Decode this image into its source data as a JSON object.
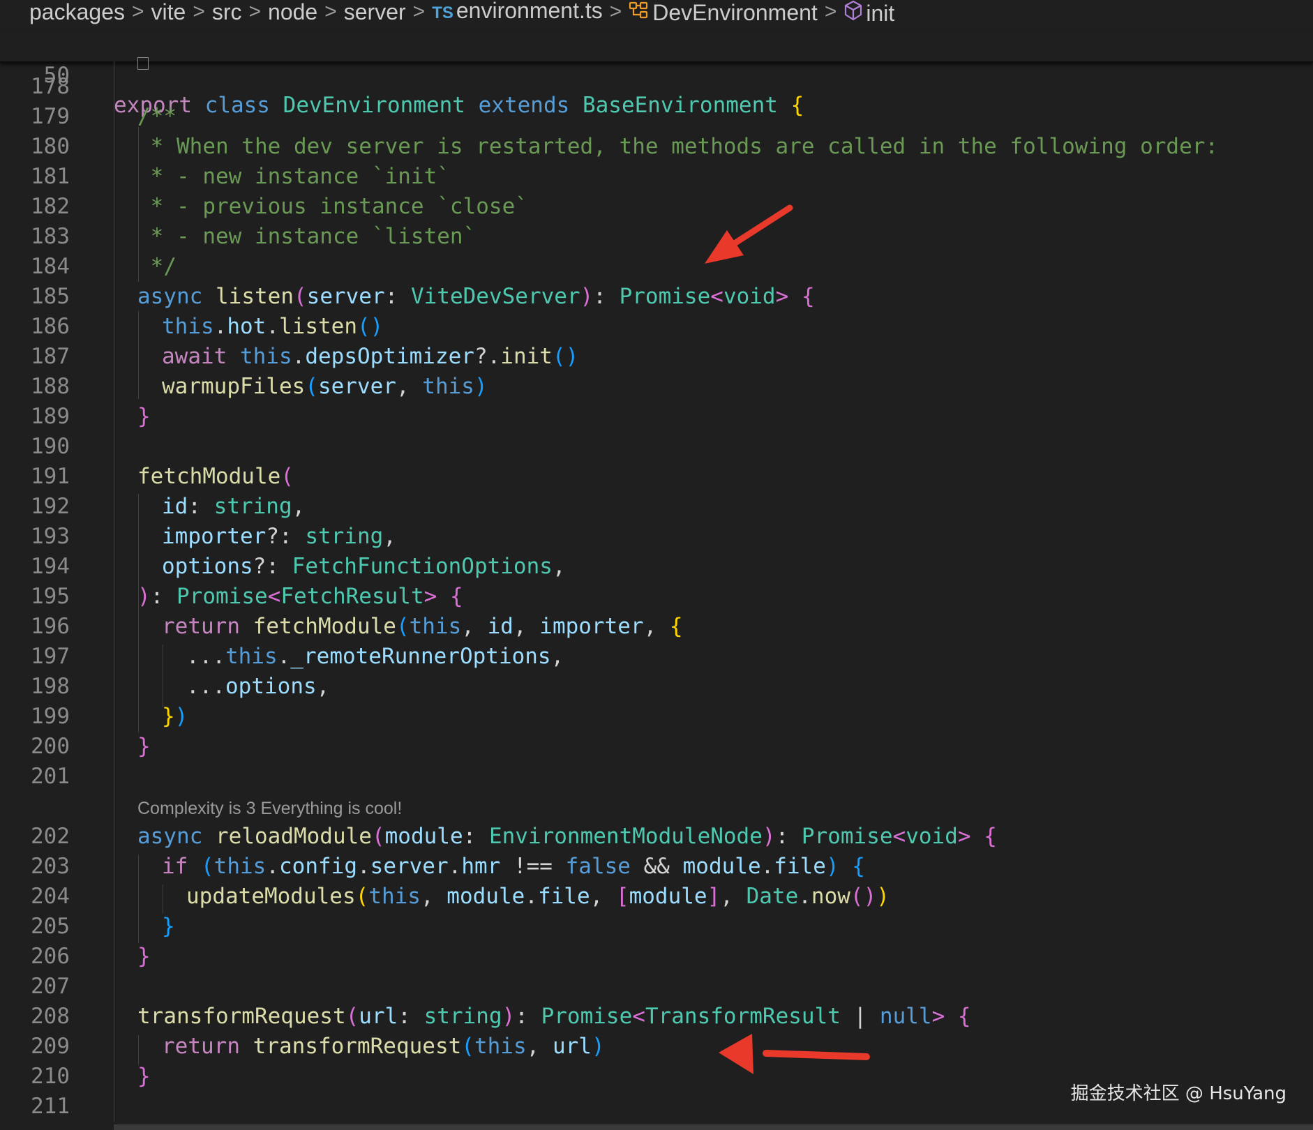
{
  "breadcrumb": {
    "items": [
      "packages",
      "vite",
      "src",
      "node",
      "server"
    ],
    "ts_badge": "TS",
    "file": "environment.ts",
    "class": "DevEnvironment",
    "method": "init",
    "separator": ">"
  },
  "sticky": {
    "line_number": "50",
    "kw_export": "export",
    "kw_class": "class",
    "class_name": "DevEnvironment",
    "kw_extends": "extends",
    "base_class": "BaseEnvironment",
    "brace": "{"
  },
  "lines": [
    {
      "n": "178"
    },
    {
      "n": "179",
      "cm": "/**"
    },
    {
      "n": "180",
      "cm": " * When the dev server is restarted, the methods are called in the following order:"
    },
    {
      "n": "181",
      "cm": " * - new instance `init`"
    },
    {
      "n": "182",
      "cm": " * - previous instance `close`"
    },
    {
      "n": "183",
      "cm": " * - new instance `listen`"
    },
    {
      "n": "184",
      "cm": " */"
    },
    {
      "n": "185"
    },
    {
      "n": "186"
    },
    {
      "n": "187"
    },
    {
      "n": "188"
    },
    {
      "n": "189"
    },
    {
      "n": "190"
    },
    {
      "n": "191"
    },
    {
      "n": "192"
    },
    {
      "n": "193"
    },
    {
      "n": "194"
    },
    {
      "n": "195"
    },
    {
      "n": "196"
    },
    {
      "n": "197"
    },
    {
      "n": "198"
    },
    {
      "n": "199"
    },
    {
      "n": "200"
    },
    {
      "n": "201"
    },
    {
      "n": "202"
    },
    {
      "n": "203"
    },
    {
      "n": "204"
    },
    {
      "n": "205"
    },
    {
      "n": "206"
    },
    {
      "n": "207"
    },
    {
      "n": "208"
    },
    {
      "n": "209"
    },
    {
      "n": "210"
    },
    {
      "n": "211"
    }
  ],
  "code": {
    "async": "async",
    "listen": "listen",
    "server": "server",
    "ViteDevServer": "ViteDevServer",
    "Promise": "Promise",
    "void": "void",
    "this": "this",
    "hot": "hot",
    "await": "await",
    "depsOptimizer": "depsOptimizer",
    "init": "init",
    "warmupFiles": "warmupFiles",
    "fetchModule": "fetchModule",
    "id": "id",
    "string": "string",
    "importer": "importer",
    "options": "options",
    "FetchFunctionOptions": "FetchFunctionOptions",
    "FetchResult": "FetchResult",
    "return": "return",
    "remoteRunnerOptions": "_remoteRunnerOptions",
    "reloadModule": "reloadModule",
    "module": "module",
    "EnvironmentModuleNode": "EnvironmentModuleNode",
    "if": "if",
    "config": "config",
    "hmr": "hmr",
    "false": "false",
    "file": "file",
    "updateModules": "updateModules",
    "Date": "Date",
    "now": "now",
    "transformRequest": "transformRequest",
    "url": "url",
    "TransformResult": "TransformResult",
    "null": "null"
  },
  "codelens": "Complexity is 3 Everything is cool!",
  "watermark": "掘金技术社区 @ HsuYang",
  "colors": {
    "arrow": "#e8392b"
  }
}
